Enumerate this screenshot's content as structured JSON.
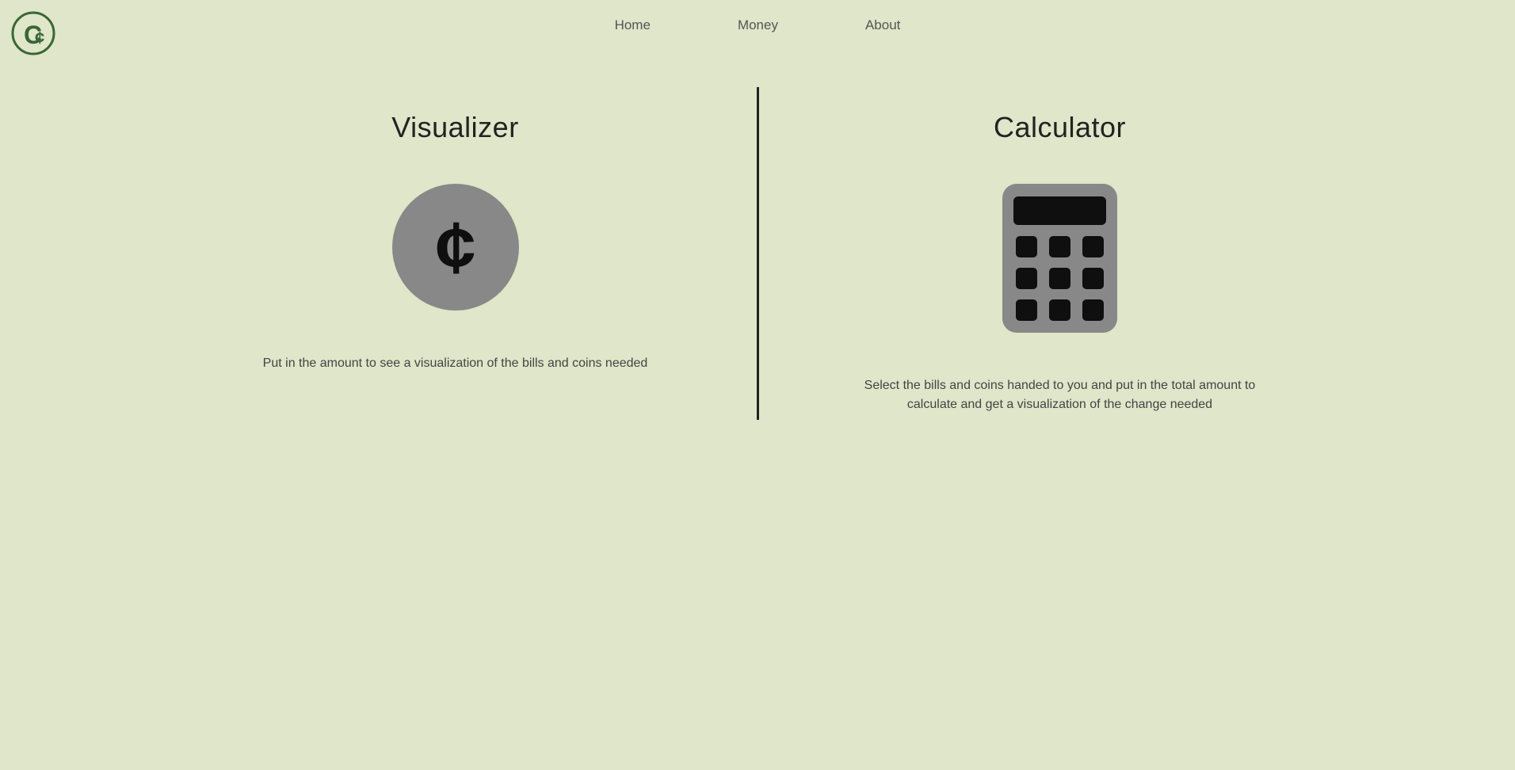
{
  "nav": {
    "home": "Home",
    "money": "Money",
    "about": "About"
  },
  "panels": {
    "visualizer": {
      "title": "Visualizer",
      "desc": "Put in the amount to see a visualization of the bills and coins needed"
    },
    "calculator": {
      "title": "Calculator",
      "desc": "Select the bills and coins handed to you and put in the total amount to calculate and get a visualization of the change needed"
    }
  }
}
